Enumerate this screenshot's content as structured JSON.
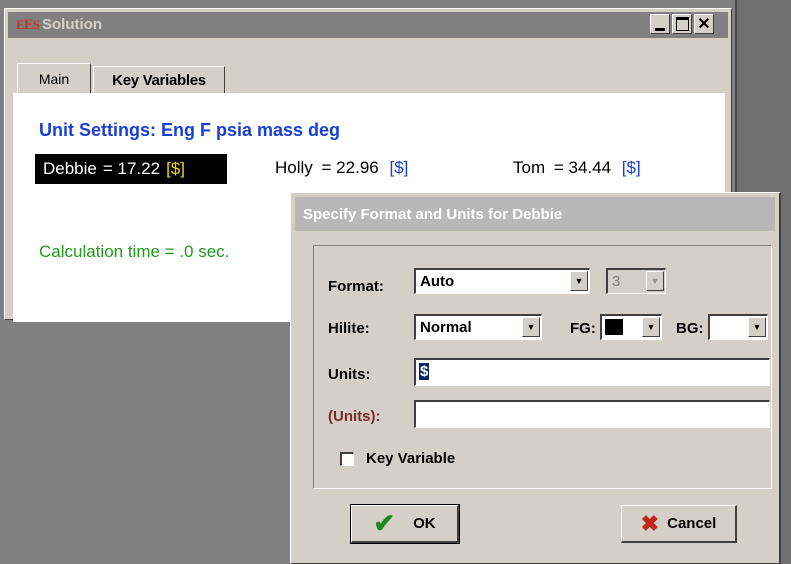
{
  "solution_window": {
    "title": "Solution",
    "icon_text": "EES",
    "tabs": [
      {
        "label": "Main",
        "active": true
      },
      {
        "label": "Key Variables",
        "active": false
      }
    ],
    "unit_settings": "Unit Settings: Eng F psia mass deg",
    "variables": [
      {
        "name": "Debbie",
        "value": "= 17.22",
        "units": "[$]",
        "selected": true
      },
      {
        "name": "Holly",
        "value": "= 22.96",
        "units": "[$]"
      },
      {
        "name": "Tom",
        "value": "= 34.44",
        "units": "[$]"
      }
    ],
    "calc_time": "Calculation time = .0 sec."
  },
  "dialog": {
    "title": "Specify Format and Units for Debbie",
    "format_label": "Format:",
    "format_value": "Auto",
    "digits_value": "3",
    "hilite_label": "Hilite:",
    "hilite_value": "Normal",
    "fg_label": "FG:",
    "bg_label": "BG:",
    "fg_color": "#000000",
    "bg_color": "#ffffff",
    "units_label": "Units:",
    "units_value": "$",
    "units_paren_label": "(Units):",
    "units_paren_value": "",
    "key_variable_label": "Key Variable",
    "key_variable_checked": false,
    "ok_label": "OK",
    "cancel_label": "Cancel"
  },
  "colors": {
    "unit_settings_text": "#1a3fd6",
    "calc_time_text": "#1f9a1f",
    "units_bracket": "#1a3fd6",
    "selected_units_bracket": "#f5d60a"
  }
}
